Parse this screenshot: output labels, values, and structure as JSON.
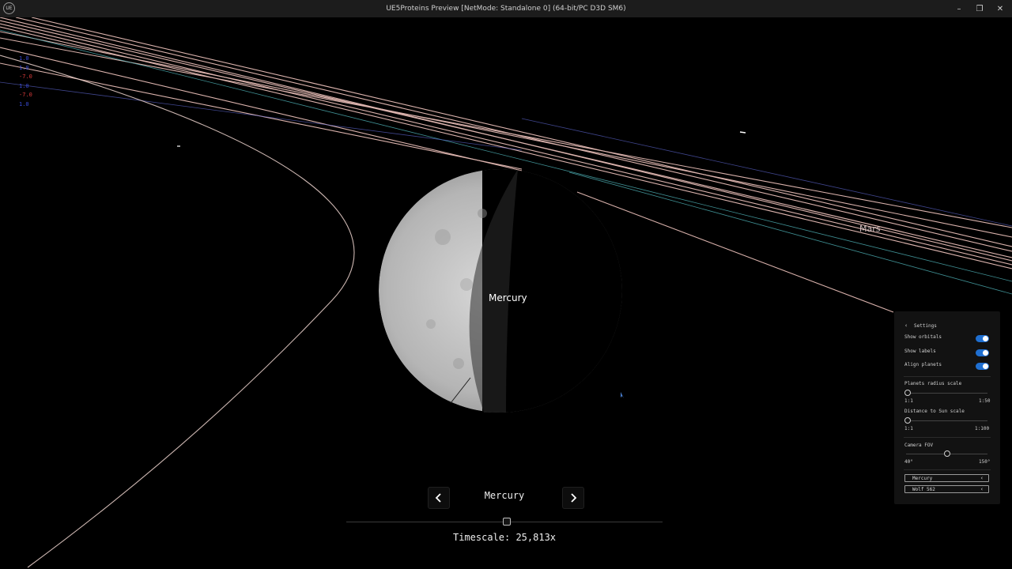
{
  "window": {
    "title": "UE5Proteins Preview [NetMode: Standalone 0]  (64-bit/PC D3D SM6)",
    "logo_text": "UE",
    "minimize": "–",
    "maximize": "❐",
    "close": "✕"
  },
  "debug_lines": [
    {
      "text": "1.0",
      "color": "#3a4bd6"
    },
    {
      "text": "1.0",
      "color": "#3a4bd6"
    },
    {
      "text": "-7.0",
      "color": "#d63a3a"
    },
    {
      "text": "1.0",
      "color": "#3a4bd6"
    },
    {
      "text": "-7.0",
      "color": "#d63a3a"
    },
    {
      "text": "1.0",
      "color": "#3a4bd6"
    }
  ],
  "scene": {
    "focused_planet_label": "Mercury",
    "mars_label": "Mars"
  },
  "navigation": {
    "prev_icon": "chevron-left-icon",
    "next_icon": "chevron-right-icon",
    "current_planet": "Mercury"
  },
  "timescale": {
    "label": "Timescale: 25,813x",
    "slider_position": 0.51
  },
  "settings": {
    "title": "Settings",
    "show_orbitals": {
      "label": "Show orbitals",
      "on": true
    },
    "show_labels": {
      "label": "Show labels",
      "on": true
    },
    "align_planets": {
      "label": "Align planets",
      "on": true
    },
    "planets_radius_scale": {
      "label": "Planets radius scale",
      "min": "1:1",
      "max": "1:50",
      "value": 0
    },
    "distance_to_sun_scale": {
      "label": "Distance to Sun scale",
      "min": "1:1",
      "max": "1:100",
      "value": 0
    },
    "camera_fov": {
      "label": "Camera FOV",
      "min": "40°",
      "max": "150°",
      "value": 0.5
    },
    "select_primary": "Mercury",
    "select_secondary": "Wolf 562"
  },
  "colors": {
    "toggle_on": "#1f6fd1",
    "orbit_pink": "#f3c7c0",
    "orbit_cyan": "#4fb3b8"
  }
}
